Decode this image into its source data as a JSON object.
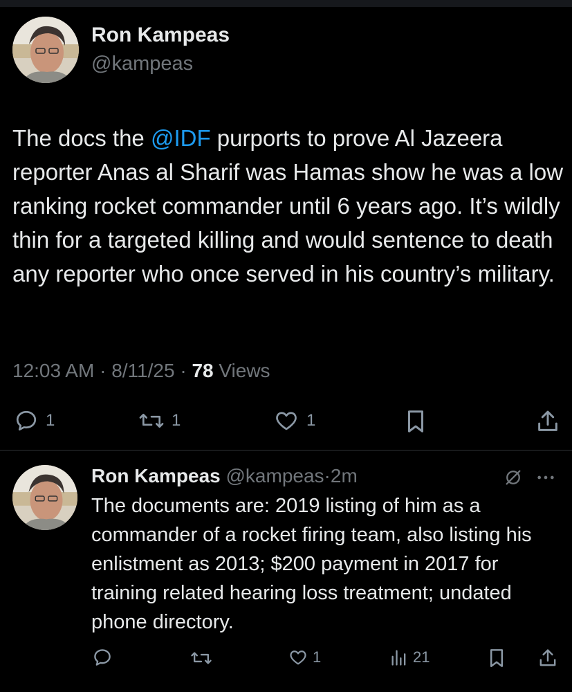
{
  "main_tweet": {
    "author_name": "Ron Kampeas",
    "author_handle": "@kampeas",
    "text_before_mention": "The docs the ",
    "mention": "@IDF",
    "text_after_mention": " purports to prove Al Jazeera reporter Anas al Sharif was Hamas show he was a low ranking rocket commander until 6 years ago. It’s wildly thin for a targeted killing and would sentence to death any reporter who once served in his country’s military.",
    "time": "12:03 AM",
    "date": "8/11/25",
    "views_count": "78",
    "views_label": "Views",
    "dot": "·",
    "actions": {
      "reply_count": "1",
      "retweet_count": "1",
      "like_count": "1"
    }
  },
  "reply_tweet": {
    "author_name": "Ron Kampeas",
    "author_handle": "@kampeas",
    "dot": "·",
    "time": "2m",
    "text": "The documents are: 2019 listing of him as a commander of a rocket firing team, also listing his enlistment as 2013; $200 payment in 2017 for training related hearing loss treatment; undated phone directory.",
    "actions": {
      "like_count": "1",
      "views_count": "21"
    }
  },
  "colors": {
    "background": "#000000",
    "text": "#e7e9ea",
    "secondary": "#71767b",
    "mention": "#1d9bf0",
    "divider": "#2f3336"
  }
}
